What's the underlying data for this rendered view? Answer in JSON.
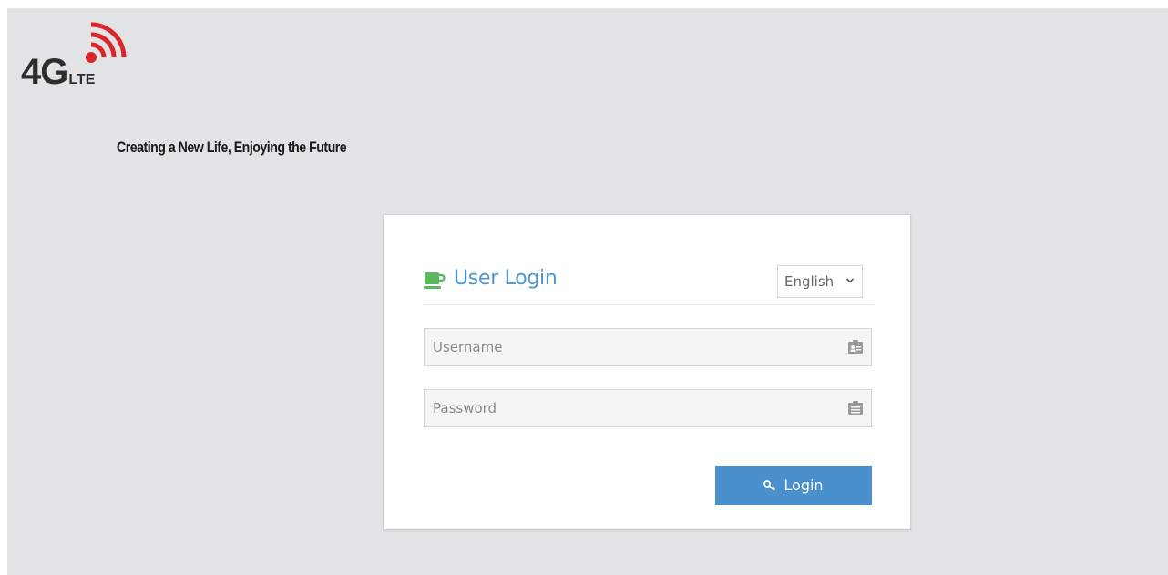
{
  "header": {
    "logo_main": "4G",
    "logo_sub": "LTE",
    "tagline": "Creating a New Life,  Enjoying the Future"
  },
  "login": {
    "title": "User Login",
    "language": {
      "selected": "English"
    },
    "username": {
      "placeholder": "Username",
      "value": ""
    },
    "password": {
      "placeholder": "Password",
      "value": ""
    },
    "submit_label": "Login"
  },
  "icons": {
    "title": "coffee-cup-icon",
    "signal": "signal-waves-icon",
    "username": "user-card-icon",
    "password": "lock-card-icon",
    "submit": "key-icon",
    "dropdown": "chevron-down-icon"
  },
  "colors": {
    "accent": "#4d96cf",
    "button": "#4a90cd",
    "title_icon": "#5cb85c",
    "logo_signal": "#d9262b",
    "background": "#e2e3e5"
  }
}
